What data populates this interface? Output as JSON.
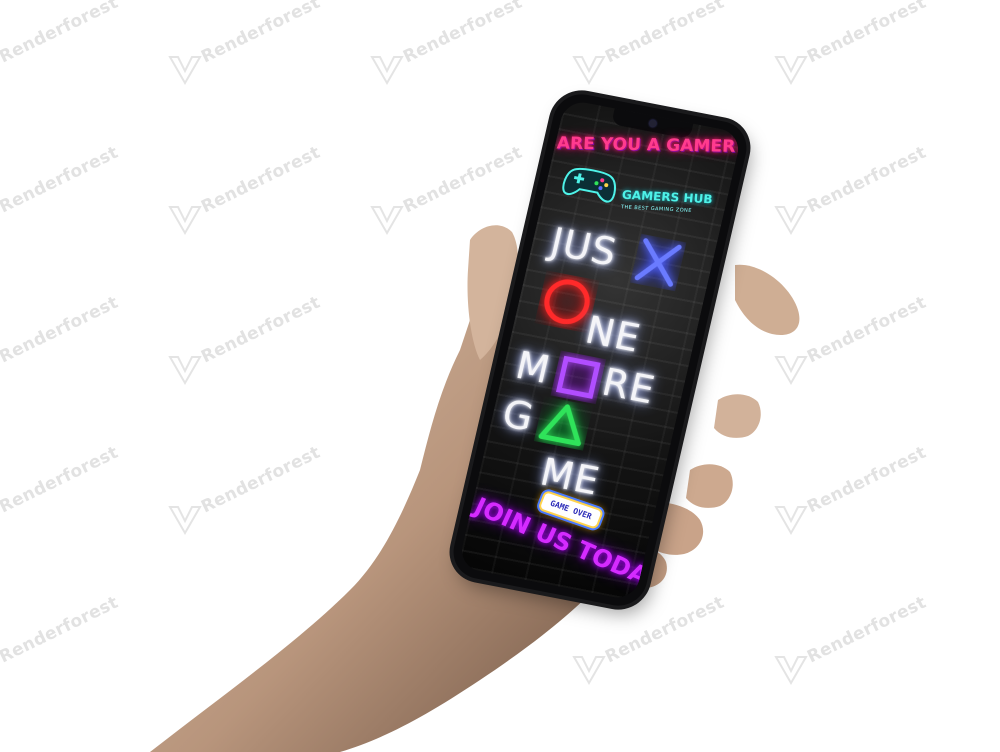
{
  "watermark": {
    "text": "Renderforest"
  },
  "poster": {
    "headline": "ARE YOU A GAMER?",
    "brand_name": "GAMERS HUB",
    "brand_tagline": "THE BEST GAMING ZONE",
    "line1": "JUS",
    "line2": "NE",
    "line3a": "M",
    "line3b": "RE",
    "line4a": "G",
    "line4b": "ME",
    "bubble_text": "GAME OVER",
    "cta": "JOIN US TODAY"
  },
  "colors": {
    "x_symbol": "#5a6bff",
    "circle_symbol": "#ff2a2a",
    "square_symbol": "#b14dff",
    "triangle_symbol": "#2fe35a",
    "headline": "#ff3b8e",
    "brand": "#4ef2e8",
    "cta": "#d52bff"
  },
  "icons": {
    "controller": "gamepad-icon",
    "cross": "cross-symbol-icon",
    "circle": "circle-symbol-icon",
    "square": "square-symbol-icon",
    "triangle": "triangle-symbol-icon"
  }
}
